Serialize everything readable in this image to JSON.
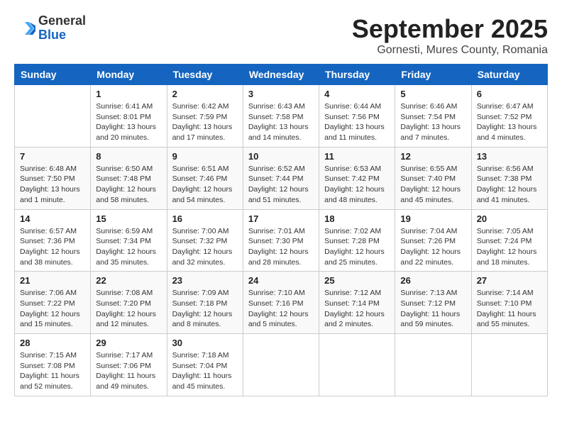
{
  "header": {
    "logo": {
      "general": "General",
      "blue": "Blue"
    },
    "month": "September 2025",
    "location": "Gornesti, Mures County, Romania"
  },
  "weekdays": [
    "Sunday",
    "Monday",
    "Tuesday",
    "Wednesday",
    "Thursday",
    "Friday",
    "Saturday"
  ],
  "weeks": [
    [
      {
        "day": "",
        "sunrise": "",
        "sunset": "",
        "daylight": ""
      },
      {
        "day": "1",
        "sunrise": "Sunrise: 6:41 AM",
        "sunset": "Sunset: 8:01 PM",
        "daylight": "Daylight: 13 hours and 20 minutes."
      },
      {
        "day": "2",
        "sunrise": "Sunrise: 6:42 AM",
        "sunset": "Sunset: 7:59 PM",
        "daylight": "Daylight: 13 hours and 17 minutes."
      },
      {
        "day": "3",
        "sunrise": "Sunrise: 6:43 AM",
        "sunset": "Sunset: 7:58 PM",
        "daylight": "Daylight: 13 hours and 14 minutes."
      },
      {
        "day": "4",
        "sunrise": "Sunrise: 6:44 AM",
        "sunset": "Sunset: 7:56 PM",
        "daylight": "Daylight: 13 hours and 11 minutes."
      },
      {
        "day": "5",
        "sunrise": "Sunrise: 6:46 AM",
        "sunset": "Sunset: 7:54 PM",
        "daylight": "Daylight: 13 hours and 7 minutes."
      },
      {
        "day": "6",
        "sunrise": "Sunrise: 6:47 AM",
        "sunset": "Sunset: 7:52 PM",
        "daylight": "Daylight: 13 hours and 4 minutes."
      }
    ],
    [
      {
        "day": "7",
        "sunrise": "Sunrise: 6:48 AM",
        "sunset": "Sunset: 7:50 PM",
        "daylight": "Daylight: 13 hours and 1 minute."
      },
      {
        "day": "8",
        "sunrise": "Sunrise: 6:50 AM",
        "sunset": "Sunset: 7:48 PM",
        "daylight": "Daylight: 12 hours and 58 minutes."
      },
      {
        "day": "9",
        "sunrise": "Sunrise: 6:51 AM",
        "sunset": "Sunset: 7:46 PM",
        "daylight": "Daylight: 12 hours and 54 minutes."
      },
      {
        "day": "10",
        "sunrise": "Sunrise: 6:52 AM",
        "sunset": "Sunset: 7:44 PM",
        "daylight": "Daylight: 12 hours and 51 minutes."
      },
      {
        "day": "11",
        "sunrise": "Sunrise: 6:53 AM",
        "sunset": "Sunset: 7:42 PM",
        "daylight": "Daylight: 12 hours and 48 minutes."
      },
      {
        "day": "12",
        "sunrise": "Sunrise: 6:55 AM",
        "sunset": "Sunset: 7:40 PM",
        "daylight": "Daylight: 12 hours and 45 minutes."
      },
      {
        "day": "13",
        "sunrise": "Sunrise: 6:56 AM",
        "sunset": "Sunset: 7:38 PM",
        "daylight": "Daylight: 12 hours and 41 minutes."
      }
    ],
    [
      {
        "day": "14",
        "sunrise": "Sunrise: 6:57 AM",
        "sunset": "Sunset: 7:36 PM",
        "daylight": "Daylight: 12 hours and 38 minutes."
      },
      {
        "day": "15",
        "sunrise": "Sunrise: 6:59 AM",
        "sunset": "Sunset: 7:34 PM",
        "daylight": "Daylight: 12 hours and 35 minutes."
      },
      {
        "day": "16",
        "sunrise": "Sunrise: 7:00 AM",
        "sunset": "Sunset: 7:32 PM",
        "daylight": "Daylight: 12 hours and 32 minutes."
      },
      {
        "day": "17",
        "sunrise": "Sunrise: 7:01 AM",
        "sunset": "Sunset: 7:30 PM",
        "daylight": "Daylight: 12 hours and 28 minutes."
      },
      {
        "day": "18",
        "sunrise": "Sunrise: 7:02 AM",
        "sunset": "Sunset: 7:28 PM",
        "daylight": "Daylight: 12 hours and 25 minutes."
      },
      {
        "day": "19",
        "sunrise": "Sunrise: 7:04 AM",
        "sunset": "Sunset: 7:26 PM",
        "daylight": "Daylight: 12 hours and 22 minutes."
      },
      {
        "day": "20",
        "sunrise": "Sunrise: 7:05 AM",
        "sunset": "Sunset: 7:24 PM",
        "daylight": "Daylight: 12 hours and 18 minutes."
      }
    ],
    [
      {
        "day": "21",
        "sunrise": "Sunrise: 7:06 AM",
        "sunset": "Sunset: 7:22 PM",
        "daylight": "Daylight: 12 hours and 15 minutes."
      },
      {
        "day": "22",
        "sunrise": "Sunrise: 7:08 AM",
        "sunset": "Sunset: 7:20 PM",
        "daylight": "Daylight: 12 hours and 12 minutes."
      },
      {
        "day": "23",
        "sunrise": "Sunrise: 7:09 AM",
        "sunset": "Sunset: 7:18 PM",
        "daylight": "Daylight: 12 hours and 8 minutes."
      },
      {
        "day": "24",
        "sunrise": "Sunrise: 7:10 AM",
        "sunset": "Sunset: 7:16 PM",
        "daylight": "Daylight: 12 hours and 5 minutes."
      },
      {
        "day": "25",
        "sunrise": "Sunrise: 7:12 AM",
        "sunset": "Sunset: 7:14 PM",
        "daylight": "Daylight: 12 hours and 2 minutes."
      },
      {
        "day": "26",
        "sunrise": "Sunrise: 7:13 AM",
        "sunset": "Sunset: 7:12 PM",
        "daylight": "Daylight: 11 hours and 59 minutes."
      },
      {
        "day": "27",
        "sunrise": "Sunrise: 7:14 AM",
        "sunset": "Sunset: 7:10 PM",
        "daylight": "Daylight: 11 hours and 55 minutes."
      }
    ],
    [
      {
        "day": "28",
        "sunrise": "Sunrise: 7:15 AM",
        "sunset": "Sunset: 7:08 PM",
        "daylight": "Daylight: 11 hours and 52 minutes."
      },
      {
        "day": "29",
        "sunrise": "Sunrise: 7:17 AM",
        "sunset": "Sunset: 7:06 PM",
        "daylight": "Daylight: 11 hours and 49 minutes."
      },
      {
        "day": "30",
        "sunrise": "Sunrise: 7:18 AM",
        "sunset": "Sunset: 7:04 PM",
        "daylight": "Daylight: 11 hours and 45 minutes."
      },
      {
        "day": "",
        "sunrise": "",
        "sunset": "",
        "daylight": ""
      },
      {
        "day": "",
        "sunrise": "",
        "sunset": "",
        "daylight": ""
      },
      {
        "day": "",
        "sunrise": "",
        "sunset": "",
        "daylight": ""
      },
      {
        "day": "",
        "sunrise": "",
        "sunset": "",
        "daylight": ""
      }
    ]
  ]
}
